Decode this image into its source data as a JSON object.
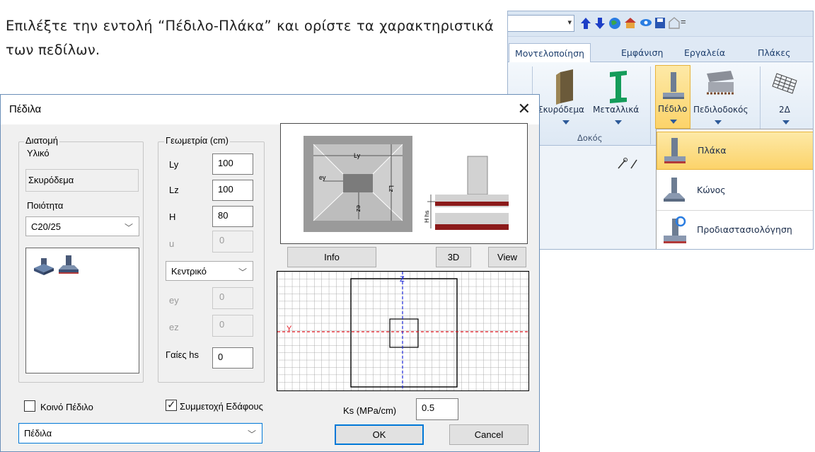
{
  "intro_text": "Επιλέξτε την εντολή “Πέδιλο-Πλάκα” και ορίστε τα χαρακτηριστικά των πεδίλων.",
  "ribbon": {
    "tabs": [
      "Μοντελοποίηση",
      "Εμφάνιση",
      "Εργαλεία",
      "Πλάκες"
    ],
    "buttons": [
      "Σκυρόδεμα",
      "Μεταλλικά",
      "Πέδιλο",
      "Πεδιλοδοκός",
      "2Δ"
    ],
    "group_label": "Δοκός",
    "menu_items": [
      "Πλάκα",
      "Κώνος",
      "Προδιαστασιολόγηση"
    ]
  },
  "dialog": {
    "title": "Πέδιλα",
    "section": {
      "legend": "Διατομή",
      "material_label": "Υλικό",
      "material_value": "Σκυρόδεμα",
      "quality_label": "Ποιότητα",
      "quality_value": "C20/25"
    },
    "geometry": {
      "legend": "Γεωμετρία (cm)",
      "ly_label": "Ly",
      "ly_value": "100",
      "lz_label": "Lz",
      "lz_value": "100",
      "h_label": "H",
      "h_value": "80",
      "u_label": "u",
      "u_value": "0",
      "position_value": "Κεντρικό",
      "ey_label": "ey",
      "ey_value": "0",
      "ez_label": "ez",
      "ez_value": "0",
      "hs_label": "Γαίες hs",
      "hs_value": "0"
    },
    "preview": {
      "ly_text": "Ly",
      "lz_text": "Lz",
      "ey_text": "ey",
      "ez_text": "ez",
      "hhs_text": "H hs"
    },
    "buttons": {
      "info": "Info",
      "view3d": "3D",
      "view": "View",
      "ok": "OK",
      "cancel": "Cancel"
    },
    "plot_axes": {
      "y": "Y",
      "z": "Z"
    },
    "common_footing_label": "Κοινό Πέδιλο",
    "common_footing_checked": false,
    "soil_participation_label": "Συμμετοχή Εδάφους",
    "soil_participation_checked": true,
    "ks_label": "Ks (MPa/cm)",
    "ks_value": "0.5",
    "layer_value": "Πέδιλα"
  },
  "colors": {
    "ribbon_bg": "#dfe9f5",
    "menu_highlight": "#fcd36a",
    "axis_red": "#e0141e",
    "axis_blue": "#1a24d8",
    "slab_red": "#8b1a1a"
  },
  "icons": [
    "column-icon",
    "steel-beam-icon",
    "footing-icon",
    "strip-footing-icon",
    "grid-slab-icon",
    "close-icon"
  ]
}
